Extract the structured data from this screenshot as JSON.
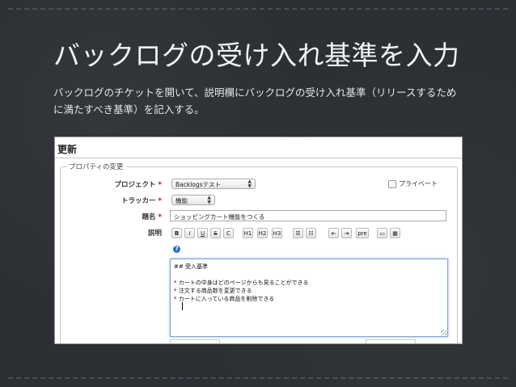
{
  "slide": {
    "title": "バックログの受け入れ基準を入力",
    "description": "バックログのチケットを開いて、説明欄にバックログの受け入れ基準（リリースするために満たすべき基準）を記入する。"
  },
  "form": {
    "header": "更新",
    "legend": "プロパティの変更",
    "project_label": "プロジェクト",
    "project_value": "Backlogsテスト",
    "private_label": "プライベート",
    "tracker_label": "トラッカー",
    "tracker_value": "機能",
    "subject_label": "題名",
    "subject_value": "ショッピングカート機能をつくる",
    "description_label": "説明",
    "required_mark": "*",
    "toolbar": [
      {
        "label": "B",
        "icon": "bold-icon"
      },
      {
        "label": "I",
        "icon": "italic-icon"
      },
      {
        "label": "U",
        "icon": "underline-icon"
      },
      {
        "label": "S",
        "icon": "strikethrough-icon"
      },
      {
        "label": "C",
        "icon": "code-icon"
      },
      {
        "label": "H1",
        "icon": "heading1-icon"
      },
      {
        "label": "H2",
        "icon": "heading2-icon"
      },
      {
        "label": "H3",
        "icon": "heading3-icon"
      },
      {
        "label": "☰",
        "icon": "unordered-list-icon"
      },
      {
        "label": "☷",
        "icon": "ordered-list-icon"
      },
      {
        "label": "⇤",
        "icon": "unindent-icon"
      },
      {
        "label": "⇥",
        "icon": "indent-icon"
      },
      {
        "label": "pre",
        "icon": "preformatted-icon"
      },
      {
        "label": "▭",
        "icon": "link-icon"
      },
      {
        "label": "▦",
        "icon": "image-icon"
      }
    ],
    "help_icon": "?",
    "description_lines": [
      "## 受入基準",
      "",
      "* カートの中身はどのページからも見ることができる",
      "* 注文する商品数を変更できる",
      "* カートに入っている商品を削除できる"
    ]
  }
}
